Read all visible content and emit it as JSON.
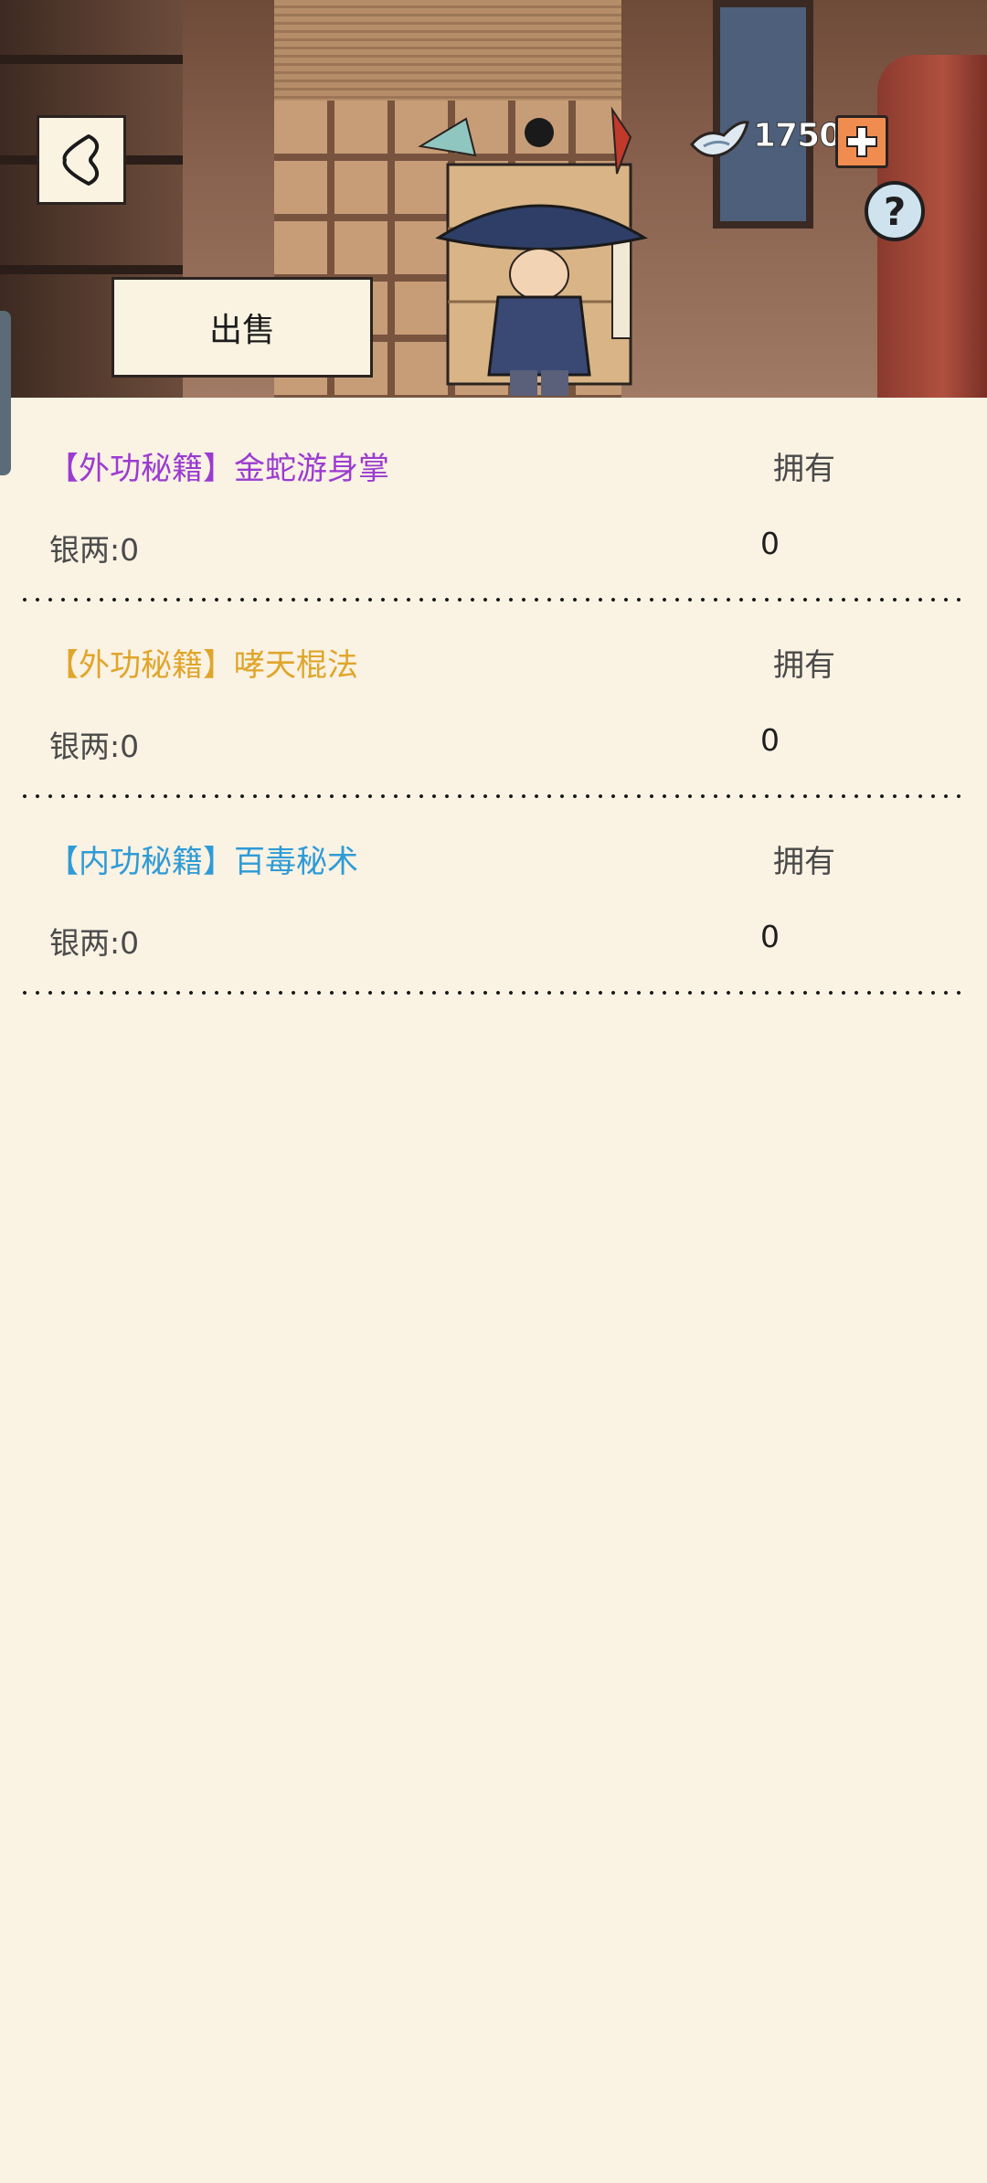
{
  "header": {
    "back_icon": "back-arrow-icon",
    "sell_label": "出售",
    "currency_icon": "silver-ingot-icon",
    "currency_value": "1750",
    "add_currency_icon": "plus-icon",
    "help_icon": "question-mark-icon",
    "help_glyph": "?"
  },
  "items": [
    {
      "title": "【外功秘籍】金蛇游身掌",
      "title_color": "#9b3bd1",
      "owned_label": "拥有",
      "price": "银两:0",
      "count": "0"
    },
    {
      "title": "【外功秘籍】哮天棍法",
      "title_color": "#e0a52a",
      "owned_label": "拥有",
      "price": "银两:0",
      "count": "0"
    },
    {
      "title": "【内功秘籍】百毒秘术",
      "title_color": "#2e9bd6",
      "owned_label": "拥有",
      "price": "银两:0",
      "count": "0"
    }
  ],
  "colors": {
    "background": "#faf2e3",
    "accent_plus": "#f08c50"
  }
}
